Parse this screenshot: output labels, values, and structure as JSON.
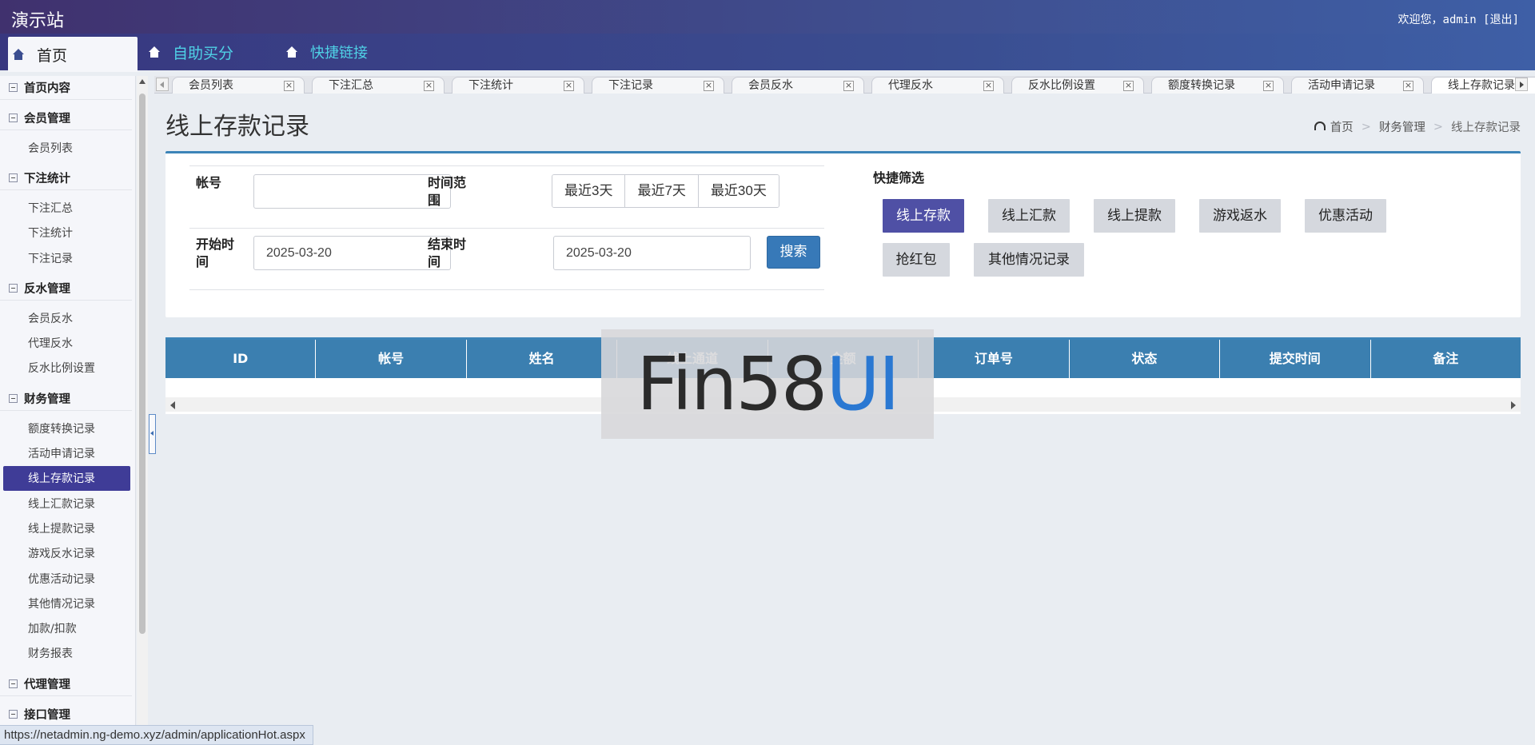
{
  "header": {
    "site_title": "演示站",
    "welcome_prefix": "欢迎您，admin [",
    "logout_label": "退出",
    "welcome_suffix": "]"
  },
  "nav": {
    "home": "首页",
    "self_service": "自助买分",
    "quick_links": "快捷链接"
  },
  "sidebar": {
    "groups": [
      {
        "label": "首页内容",
        "items": []
      },
      {
        "label": "会员管理",
        "items": [
          "会员列表"
        ]
      },
      {
        "label": "下注统计",
        "items": [
          "下注汇总",
          "下注统计",
          "下注记录"
        ]
      },
      {
        "label": "反水管理",
        "items": [
          "会员反水",
          "代理反水",
          "反水比例设置"
        ]
      },
      {
        "label": "财务管理",
        "items": [
          "额度转换记录",
          "活动申请记录",
          "线上存款记录",
          "线上汇款记录",
          "线上提款记录",
          "游戏反水记录",
          "优惠活动记录",
          "其他情况记录",
          "加款/扣款",
          "财务报表"
        ]
      },
      {
        "label": "代理管理",
        "items": []
      },
      {
        "label": "接口管理",
        "items": []
      }
    ],
    "active_item": "线上存款记录"
  },
  "tabs": [
    "会员列表",
    "下注汇总",
    "下注统计",
    "下注记录",
    "会员反水",
    "代理反水",
    "反水比例设置",
    "额度转换记录",
    "活动申请记录",
    "线上存款记录"
  ],
  "tab_close_glyph": "×",
  "page": {
    "title": "线上存款记录",
    "breadcrumb": [
      "首页",
      "财务管理",
      "线上存款记录"
    ],
    "breadcrumb_sep": ">"
  },
  "filters": {
    "account_label": "帐号",
    "account_value": "",
    "time_range_label": "时间范围",
    "ranges": [
      "最近3天",
      "最近7天",
      "最近30天"
    ],
    "start_label": "开始时间",
    "start_value": "2025-03-20",
    "end_label": "结束时间",
    "end_value": "2025-03-20",
    "search_label": "搜索"
  },
  "quick_filter": {
    "title": "快捷筛选",
    "buttons": [
      "线上存款",
      "线上汇款",
      "线上提款",
      "游戏返水",
      "优惠活动",
      "抢红包",
      "其他情况记录"
    ],
    "active": "线上存款"
  },
  "table": {
    "columns": [
      "ID",
      "帐号",
      "姓名",
      "线上通道",
      "金额",
      "订单号",
      "状态",
      "提交时间",
      "备注"
    ]
  },
  "watermark": {
    "dark": "Fin58",
    "blue": "UI"
  },
  "statusbar": {
    "url": "https://netadmin.ng-demo.xyz/admin/applicationHot.aspx"
  },
  "colors": {
    "accent": "#3c84b8",
    "header": "#40316e",
    "active_item": "#3f3c97",
    "quick_active": "#4f50a5"
  }
}
